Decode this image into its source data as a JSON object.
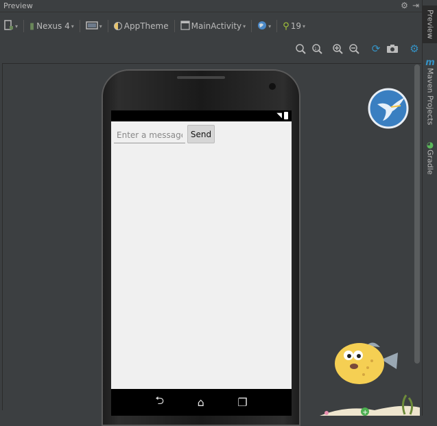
{
  "panel": {
    "title": "Preview"
  },
  "toolbar": {
    "device": "Nexus 4",
    "theme": "AppTheme",
    "activity": "MainActivity",
    "api": "19"
  },
  "sidebar": {
    "preview": "Preview",
    "maven": "Maven Projects",
    "gradle": "Gradle"
  },
  "app": {
    "message_placeholder": "Enter a message",
    "send_label": "Send"
  },
  "colors": {
    "accent": "#3592c4",
    "background": "#3c3f41"
  },
  "icons": [
    "settings-icon",
    "hide-icon",
    "device-icon",
    "orientation-icon",
    "theme-icon",
    "activity-icon",
    "locale-icon",
    "android-icon",
    "zoom-fit-icon",
    "zoom-actual-icon",
    "zoom-in-icon",
    "zoom-out-icon",
    "refresh-icon",
    "screenshot-icon",
    "options-icon"
  ]
}
